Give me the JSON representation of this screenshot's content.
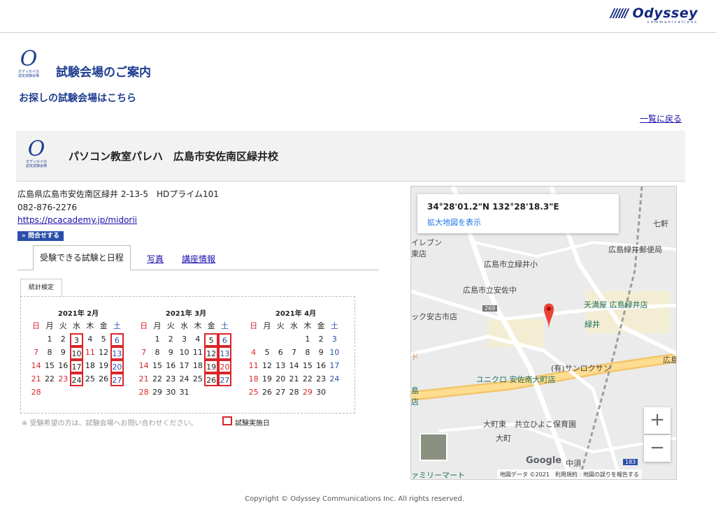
{
  "brand": {
    "name": "Odyssey",
    "sub": "communications"
  },
  "logo": {
    "letter": "O",
    "caption_line1": "オデッセイの",
    "caption_line2": "認定試験会場"
  },
  "header": {
    "title": "試験会場のご案内",
    "subtitle": "お探しの試験会場はこちら",
    "back_link": "一覧に戻る"
  },
  "venue": {
    "name": "パソコン教室パレハ　広島市安佐南区緑井校",
    "address": "広島県広島市安佐南区緑井 2-13-5　HDプライム101",
    "phone": "082-876-2276",
    "url": "https://pcacademy.jp/midorii",
    "inquiry_button": "» 問合せする"
  },
  "tabs": [
    {
      "label": "受験できる試験と日程"
    },
    {
      "label": "写真"
    },
    {
      "label": "講座情報"
    }
  ],
  "calendar": {
    "exam_tab": "統計検定",
    "weekdays": [
      "日",
      "月",
      "火",
      "水",
      "木",
      "金",
      "土"
    ],
    "months": [
      {
        "title": "2021年 2月",
        "days": [
          "",
          "1",
          "2",
          "3",
          "4",
          "5",
          "6",
          "7",
          "8",
          "9",
          "10",
          "11",
          "12",
          "13",
          "14",
          "15",
          "16",
          "17",
          "18",
          "19",
          "20",
          "21",
          "22",
          "23",
          "24",
          "25",
          "26",
          "27",
          "28"
        ]
      },
      {
        "title": "2021年 3月",
        "days": [
          "",
          "1",
          "2",
          "3",
          "4",
          "5",
          "6",
          "7",
          "8",
          "9",
          "10",
          "11",
          "12",
          "13",
          "14",
          "15",
          "16",
          "17",
          "18",
          "19",
          "20",
          "21",
          "22",
          "23",
          "24",
          "25",
          "26",
          "27",
          "28",
          "29",
          "30",
          "31"
        ]
      },
      {
        "title": "2021年 4月",
        "days": [
          "",
          "",
          "",
          "",
          "1",
          "2",
          "3",
          "4",
          "5",
          "6",
          "7",
          "8",
          "9",
          "10",
          "11",
          "12",
          "13",
          "14",
          "15",
          "16",
          "17",
          "18",
          "19",
          "20",
          "21",
          "22",
          "23",
          "24",
          "25",
          "26",
          "27",
          "28",
          "29",
          "30"
        ]
      }
    ],
    "note": "※ 受験希望の方は、試験会場へお問い合わせください。",
    "legend": "試験実施日"
  },
  "map": {
    "coords": "34°28'01.2\"N 132°28'18.3\"E",
    "enlarge": "拡大地図を表示",
    "labels": {
      "l1": "七軒",
      "l2": "イレブン",
      "l3": "東店",
      "l4": "広島緑井郵便局",
      "l5": "広島市立緑井小",
      "l6": "広島市立安佐中",
      "l7": "269",
      "l8": "天満屋 広島緑井店",
      "l9": "ック安古市店",
      "l10": "緑井",
      "l11": "(有)サンロクサン",
      "l12": "ユニクロ 安佐南大町店",
      "l13": "大町東",
      "l14": "共立ひよこ保育園",
      "l15": "大町",
      "l16": "ァミリーマート",
      "l17": "中須",
      "l18": "183",
      "l19": "島",
      "l20": "店",
      "l21": "広島",
      "l22": "ド"
    },
    "zoom_in": "+",
    "zoom_out": "−",
    "google": "Google",
    "attribution": "地図データ ©2021　利用規約　地図の誤りを報告する"
  },
  "footer": {
    "copyright": "Copyright © Odyssey Communications Inc. All rights reserved."
  }
}
